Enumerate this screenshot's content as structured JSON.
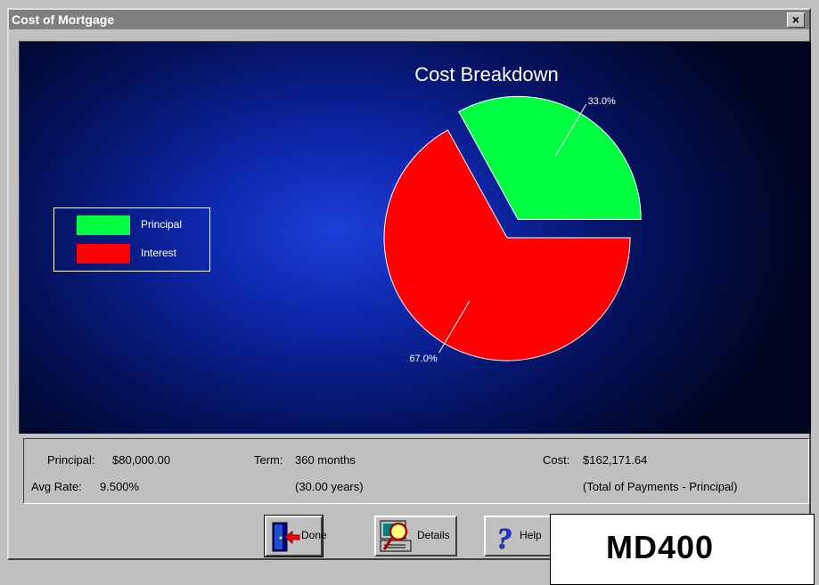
{
  "window": {
    "title": "Cost of Mortgage",
    "close_glyph": "×"
  },
  "legend": [
    {
      "label": "Principal",
      "color": "#00ff40"
    },
    {
      "label": "Interest",
      "color": "#ff0000"
    }
  ],
  "info": {
    "principal_label": "Principal:",
    "principal_value": "$80,000.00",
    "avg_rate_label": "Avg Rate:",
    "avg_rate_value": "9.500%",
    "term_label": "Term:",
    "term_value": "360 months",
    "term_years": "(30.00 years)",
    "cost_label": "Cost:",
    "cost_value": "$162,171.64",
    "cost_note": "(Total of Payments - Principal)"
  },
  "buttons": {
    "done": "Done",
    "details": "Details",
    "help": "Help"
  },
  "overlay_label": "MD400",
  "chart_data": {
    "type": "pie",
    "title": "Cost Breakdown",
    "categories": [
      "Principal",
      "Interest"
    ],
    "values": [
      33.0,
      67.0
    ],
    "value_labels": [
      "33.0%",
      "67.0%"
    ],
    "colors": [
      "#00ff40",
      "#ff0000"
    ],
    "exploded": [
      "Principal"
    ],
    "legend_position": "left"
  }
}
